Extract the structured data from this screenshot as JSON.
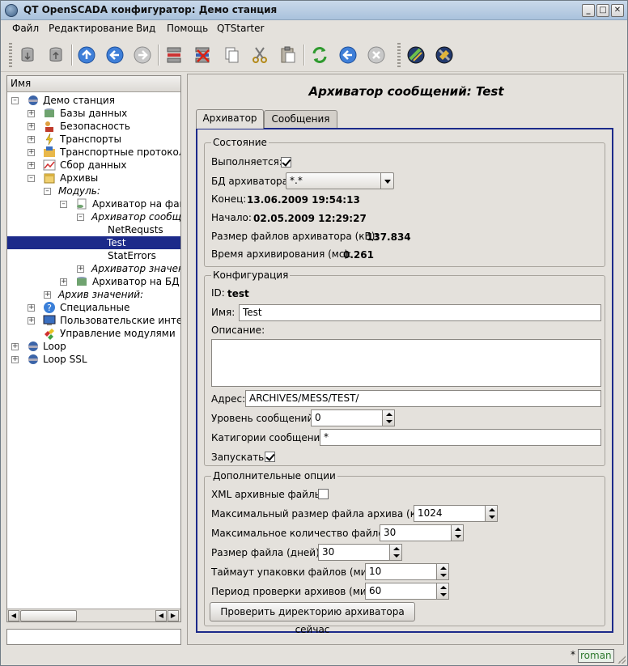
{
  "window": {
    "title": "QT OpenSCADA конфигуратор: Демо станция",
    "controls": [
      "minimize-icon",
      "maximize-icon",
      "close-icon"
    ]
  },
  "menu": {
    "file": "Файл",
    "edit": "Редактирование",
    "view": "Вид",
    "help": "Помощь",
    "qtstarter": "QTStarter"
  },
  "toolbar": {
    "icons": [
      "db-load-icon",
      "db-save-icon",
      "up-icon",
      "back-icon",
      "forward-icon",
      "add-item-icon",
      "delete-item-icon",
      "copy-icon",
      "cut-icon",
      "paste-icon",
      "refresh-icon",
      "start-icon",
      "stop-icon",
      "ui-vision-icon",
      "ui-develop-icon"
    ]
  },
  "tree": {
    "header": "Имя",
    "items": [
      {
        "label": "Демо станция",
        "italic": false
      },
      {
        "label": "Базы данных",
        "italic": false
      },
      {
        "label": "Безопасность",
        "italic": false
      },
      {
        "label": "Транспорты",
        "italic": false
      },
      {
        "label": "Транспортные протоколы",
        "italic": false
      },
      {
        "label": "Сбор данных",
        "italic": false
      },
      {
        "label": "Архивы",
        "italic": false
      },
      {
        "label": "Модуль:",
        "italic": true
      },
      {
        "label": "Архиватор на файл",
        "italic": false
      },
      {
        "label": "Архиватор сообще",
        "italic": true
      },
      {
        "label": "NetRequsts",
        "italic": false
      },
      {
        "label": "Test",
        "italic": false
      },
      {
        "label": "StatErrors",
        "italic": false
      },
      {
        "label": "Архиватор значен",
        "italic": true
      },
      {
        "label": "Архиватор на БД",
        "italic": false
      },
      {
        "label": "Архив значений:",
        "italic": true
      },
      {
        "label": "Специальные",
        "italic": false
      },
      {
        "label": "Пользовательские интерф",
        "italic": false
      },
      {
        "label": "Управление модулями",
        "italic": false
      },
      {
        "label": "Loop",
        "italic": false
      },
      {
        "label": "Loop SSL",
        "italic": false
      }
    ],
    "selected": "Test"
  },
  "panel": {
    "title": "Архиватор сообщений: Test",
    "tabs": {
      "archiver": "Архиватор",
      "messages": "Сообщения"
    },
    "state": {
      "title": "Состояние",
      "running_label": "Выполняется:",
      "running": true,
      "db_label": "БД архиватора:",
      "db_value": "*.*",
      "end_label": "Конец:",
      "end_value": "13.06.2009 19:54:13",
      "begin_label": "Начало:",
      "begin_value": "02.05.2009 12:29:27",
      "size_label": "Размер файлов архиватора (кБ):",
      "size_value": "137.834",
      "time_label": "Время архивирования (мс):",
      "time_value": "0.261"
    },
    "config": {
      "title": "Конфигурация",
      "id_label": "ID:",
      "id_value": "test",
      "name_label": "Имя:",
      "name_value": "Test",
      "descr_label": "Описание:",
      "descr_value": "",
      "addr_label": "Адрес:",
      "addr_value": "ARCHIVES/MESS/TEST/",
      "level_label": "Уровень сообщений:",
      "level_value": "0",
      "categ_label": "Катигории сообщений:",
      "categ_value": "*",
      "start_label": "Запускать:",
      "start": true
    },
    "extra": {
      "title": "Дополнительные опции",
      "xml_label": "XML архивные файлы:",
      "xml": false,
      "maxsize_label": "Максимальный размер файла архива (кБ):",
      "maxsize_value": "1024",
      "maxfiles_label": "Максимальное количество файлов:",
      "maxfiles_value": "30",
      "filesize_label": "Размер файла (дней):",
      "filesize_value": "30",
      "pack_label": "Таймаут упаковки файлов (мин):",
      "pack_value": "10",
      "check_label": "Период проверки архивов (мин):",
      "check_value": "60",
      "check_button": "Проверить директорию архиватора сейчас"
    }
  },
  "status": {
    "modified": "*",
    "user": "roman"
  }
}
